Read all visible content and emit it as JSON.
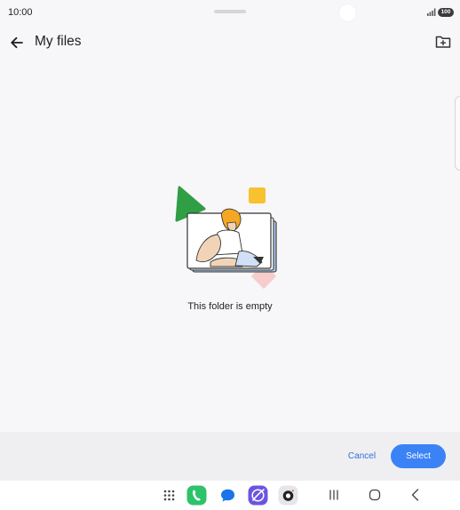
{
  "status_bar": {
    "time": "10:00",
    "battery": "100",
    "icons": [
      "signal-icon",
      "battery-icon"
    ]
  },
  "app_bar": {
    "title": "My files",
    "back_icon": "arrow-left-icon",
    "new_folder_icon": "create-folder-icon"
  },
  "empty_state": {
    "message": "This folder is empty",
    "illustration": "empty-folder-illustration"
  },
  "actions": {
    "cancel_label": "Cancel",
    "select_label": "Select"
  },
  "dock": {
    "apps": [
      "apps-grid-icon",
      "phone-icon",
      "messages-icon",
      "internet-icon",
      "camera-icon"
    ]
  },
  "nav": [
    "recents-icon",
    "home-icon",
    "back-icon"
  ],
  "colors": {
    "background": "#f7f7f9",
    "accent": "#3b82f6",
    "cancel_text": "#2f6fde",
    "action_bar": "#efeff1"
  }
}
